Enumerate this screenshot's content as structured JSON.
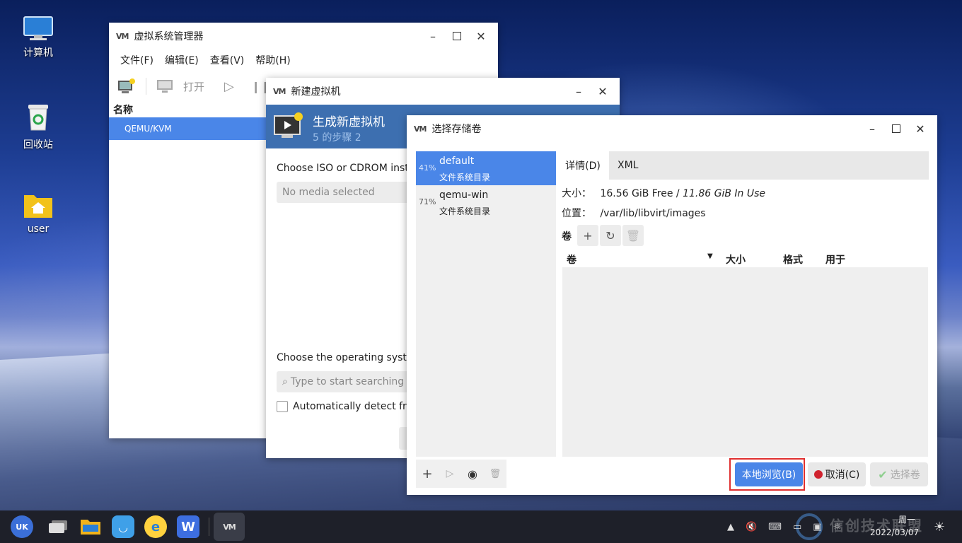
{
  "desktop": {
    "icons": [
      {
        "label": "计算机",
        "icon": "computer-icon"
      },
      {
        "label": "回收站",
        "icon": "trash-icon"
      },
      {
        "label": "user",
        "icon": "home-folder-icon"
      }
    ]
  },
  "manager": {
    "title": "虚拟系统管理器",
    "logo": "VM",
    "menu": [
      "文件(F)",
      "编辑(E)",
      "查看(V)",
      "帮助(H)"
    ],
    "toolbar_open": "打开",
    "list_header": "名称",
    "connection": "QEMU/KVM"
  },
  "newvm": {
    "title": "新建虚拟机",
    "header_title": "生成新虚拟机",
    "header_step": "5 的步骤 2",
    "iso_label": "Choose ISO or CDROM insta",
    "iso_placeholder": "No media selected",
    "os_label": "Choose the operating syste",
    "os_search_placeholder": "Type to start searching",
    "auto_detect": "Automatically detect fro"
  },
  "storage": {
    "title": "选择存储卷",
    "pools": [
      {
        "usage": "41%",
        "name": "default",
        "type": "文件系统目录",
        "selected": true
      },
      {
        "usage": "71%",
        "name": "qemu-win",
        "type": "文件系统目录",
        "selected": false
      }
    ],
    "tabs": [
      "详情(D)",
      "XML"
    ],
    "size_label": "大小：",
    "size_free": "16.56 GiB Free /",
    "size_used": "11.86 GiB In Use",
    "location_label": "位置：",
    "location_value": "/var/lib/libvirt/images",
    "volumes_label": "卷",
    "columns": [
      "卷",
      "大小",
      "格式",
      "用于"
    ],
    "browse_button": "本地浏览(B)",
    "cancel_button": "取消(C)",
    "choose_button": "选择卷"
  },
  "taskbar": {
    "day": "周一",
    "date": "2022/03/07",
    "watermark": "信创技术联盟"
  },
  "colors": {
    "accent": "#4a86e8",
    "header_band": "#3d6fb0",
    "highlight_border": "#e03030",
    "taskbar": "#1e2029"
  }
}
